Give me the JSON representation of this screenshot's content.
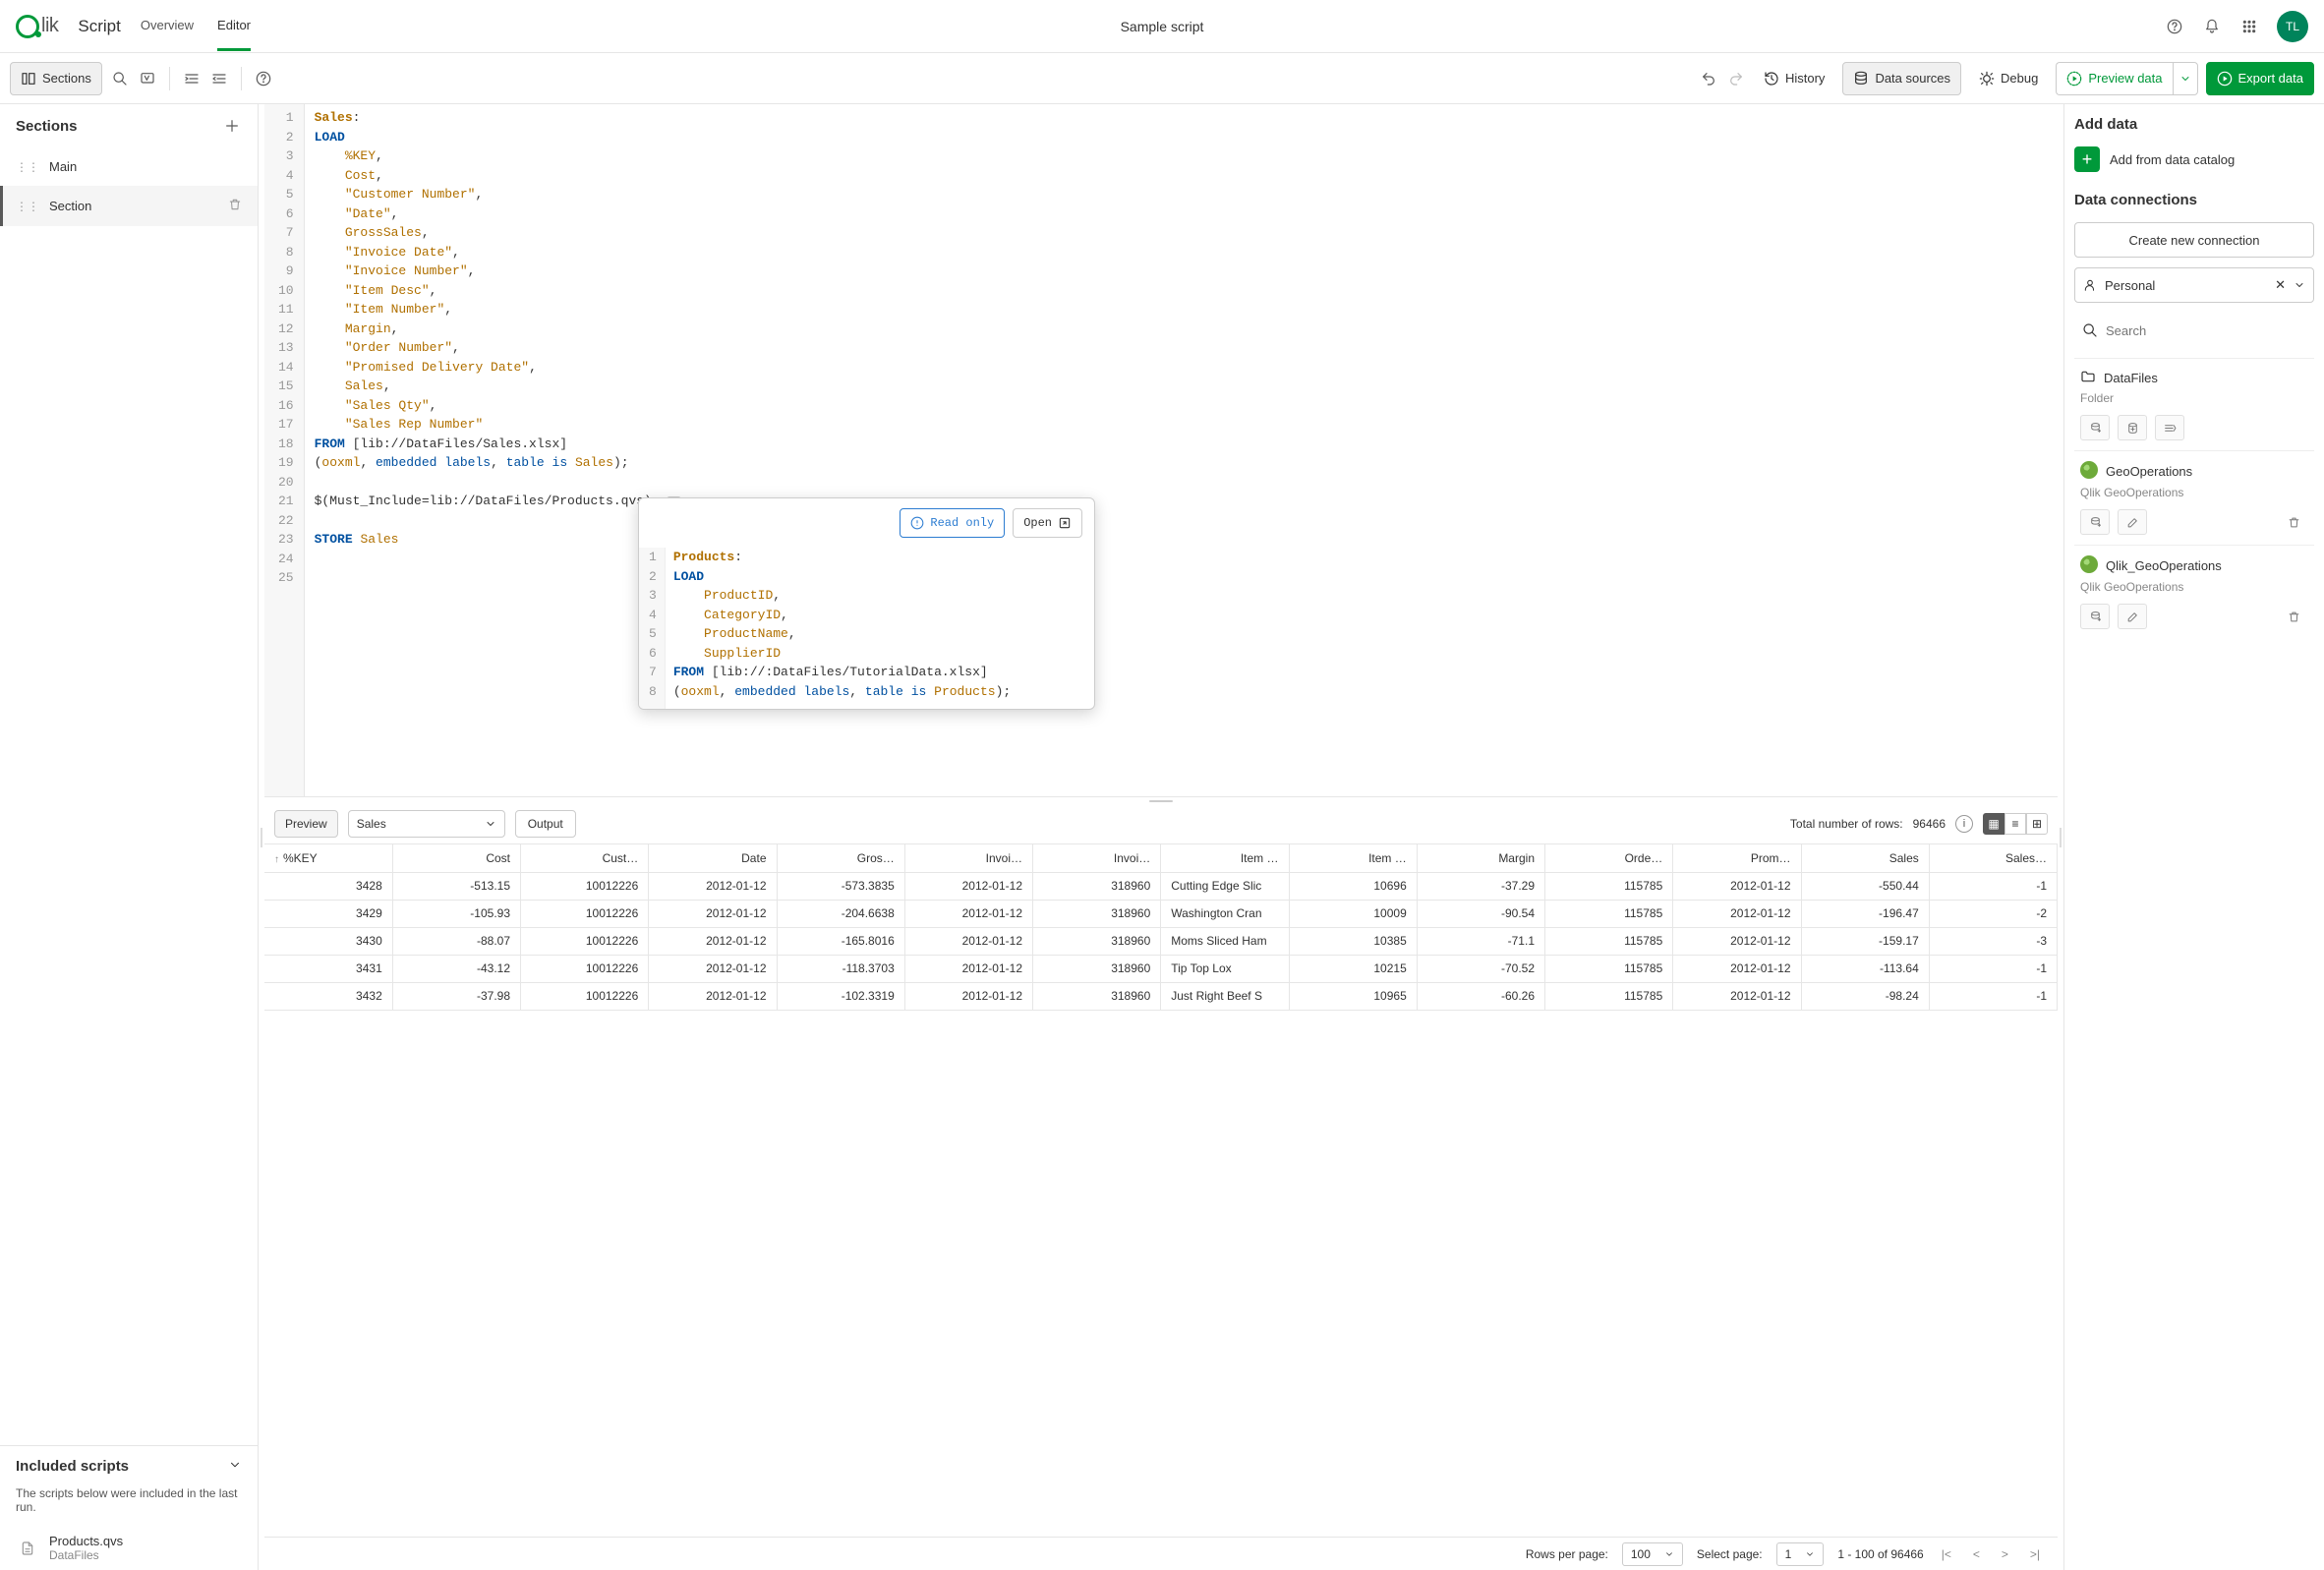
{
  "header": {
    "logo_text": "lik",
    "title": "Script",
    "tabs": [
      "Overview",
      "Editor"
    ],
    "active_tab": 1,
    "center_title": "Sample script",
    "avatar": "TL"
  },
  "toolbar": {
    "sections": "Sections",
    "history": "History",
    "datasources": "Data sources",
    "debug": "Debug",
    "preview": "Preview data",
    "export": "Export data"
  },
  "sections": {
    "title": "Sections",
    "items": [
      {
        "label": "Main",
        "active": false
      },
      {
        "label": "Section",
        "active": true
      }
    ]
  },
  "included": {
    "title": "Included scripts",
    "desc": "The scripts below were included in the last run.",
    "items": [
      {
        "name": "Products.qvs",
        "sub": "DataFiles"
      }
    ]
  },
  "code": {
    "lines": [
      {
        "n": 1,
        "html": "<span class='kw-label'>Sales</span>:"
      },
      {
        "n": 2,
        "html": "<span class='kw-load'>LOAD</span>"
      },
      {
        "n": 3,
        "html": "    <span class='kw-ident'>%KEY</span>,"
      },
      {
        "n": 4,
        "html": "    <span class='kw-ident'>Cost</span>,"
      },
      {
        "n": 5,
        "html": "    <span class='kw-str'>\"Customer Number\"</span>,"
      },
      {
        "n": 6,
        "html": "    <span class='kw-str'>\"Date\"</span>,"
      },
      {
        "n": 7,
        "html": "    <span class='kw-ident'>GrossSales</span>,"
      },
      {
        "n": 8,
        "html": "    <span class='kw-str'>\"Invoice Date\"</span>,"
      },
      {
        "n": 9,
        "html": "    <span class='kw-str'>\"Invoice Number\"</span>,"
      },
      {
        "n": 10,
        "html": "    <span class='kw-str'>\"Item Desc\"</span>,"
      },
      {
        "n": 11,
        "html": "    <span class='kw-str'>\"Item Number\"</span>,"
      },
      {
        "n": 12,
        "html": "    <span class='kw-ident'>Margin</span>,"
      },
      {
        "n": 13,
        "html": "    <span class='kw-str'>\"Order Number\"</span>,"
      },
      {
        "n": 14,
        "html": "    <span class='kw-str'>\"Promised Delivery Date\"</span>,"
      },
      {
        "n": 15,
        "html": "    <span class='kw-ident'>Sales</span>,"
      },
      {
        "n": 16,
        "html": "    <span class='kw-str'>\"Sales Qty\"</span>,"
      },
      {
        "n": 17,
        "html": "    <span class='kw-str'>\"Sales Rep Number\"</span>"
      },
      {
        "n": 18,
        "html": "<span class='kw-from'>FROM</span> [lib://DataFiles/Sales.xlsx]"
      },
      {
        "n": 19,
        "html": "(<span class='kw-ident'>ooxml</span>, <span class='kw-blue'>embedded</span> <span class='kw-blue'>labels</span>, <span class='kw-blue'>table</span> <span class='kw-blue'>is</span> <span class='kw-ident'>Sales</span>);"
      },
      {
        "n": 20,
        "html": ""
      },
      {
        "n": 21,
        "html": "$(Must_Include=lib://DataFiles/Products.qvs); <span style='border:1px solid #ccc;border-radius:3px;padding:0 3px;font-size:10px;color:#888;'>◇</span>"
      },
      {
        "n": 22,
        "html": ""
      },
      {
        "n": 23,
        "html": "<span class='kw-store'>STORE</span> <span class='kw-ident'>Sales</span>"
      },
      {
        "n": 24,
        "html": ""
      },
      {
        "n": 25,
        "html": ""
      }
    ]
  },
  "popup": {
    "readonly": "Read only",
    "open": "Open",
    "lines": [
      {
        "n": 1,
        "html": "<span class='kw-label'>Products</span>:"
      },
      {
        "n": 2,
        "html": "<span class='kw-load'>LOAD</span>"
      },
      {
        "n": 3,
        "html": "    <span class='kw-ident'>ProductID</span>,"
      },
      {
        "n": 4,
        "html": "    <span class='kw-ident'>CategoryID</span>,"
      },
      {
        "n": 5,
        "html": "    <span class='kw-ident'>ProductName</span>,"
      },
      {
        "n": 6,
        "html": "    <span class='kw-ident'>SupplierID</span>"
      },
      {
        "n": 7,
        "html": "<span class='kw-from'>FROM</span> [lib://:DataFiles/TutorialData.xlsx]"
      },
      {
        "n": 8,
        "html": "(<span class='kw-ident'>ooxml</span>, <span class='kw-blue'>embedded</span> <span class='kw-blue'>labels</span>, <span class='kw-blue'>table</span> <span class='kw-blue'>is</span> <span class='kw-ident'>Products</span>);"
      }
    ]
  },
  "right": {
    "add_data": "Add data",
    "catalog": "Add from data catalog",
    "connections_title": "Data connections",
    "create_conn": "Create new connection",
    "selected_space": "Personal",
    "search_placeholder": "Search",
    "connections": [
      {
        "name": "DataFiles",
        "sub": "Folder",
        "icon": "folder"
      },
      {
        "name": "GeoOperations",
        "sub": "Qlik GeoOperations",
        "icon": "globe"
      },
      {
        "name": "Qlik_GeoOperations",
        "sub": "Qlik GeoOperations",
        "icon": "globe"
      }
    ]
  },
  "preview": {
    "tab": "Preview",
    "table_select": "Sales",
    "output": "Output",
    "total_label": "Total number of rows:",
    "total": "96466",
    "columns": [
      "%KEY",
      "Cost",
      "Cust…",
      "Date",
      "Gros…",
      "Invoi…",
      "Invoi…",
      "Item …",
      "Item …",
      "Margin",
      "Orde…",
      "Prom…",
      "Sales",
      "Sales…"
    ],
    "rows": [
      [
        "3428",
        "-513.15",
        "10012226",
        "2012-01-12",
        "-573.3835",
        "2012-01-12",
        "318960",
        "Cutting Edge Slic",
        "10696",
        "-37.29",
        "115785",
        "2012-01-12",
        "-550.44",
        "-1"
      ],
      [
        "3429",
        "-105.93",
        "10012226",
        "2012-01-12",
        "-204.6638",
        "2012-01-12",
        "318960",
        "Washington Cran",
        "10009",
        "-90.54",
        "115785",
        "2012-01-12",
        "-196.47",
        "-2"
      ],
      [
        "3430",
        "-88.07",
        "10012226",
        "2012-01-12",
        "-165.8016",
        "2012-01-12",
        "318960",
        "Moms Sliced Ham",
        "10385",
        "-71.1",
        "115785",
        "2012-01-12",
        "-159.17",
        "-3"
      ],
      [
        "3431",
        "-43.12",
        "10012226",
        "2012-01-12",
        "-118.3703",
        "2012-01-12",
        "318960",
        "Tip Top Lox",
        "10215",
        "-70.52",
        "115785",
        "2012-01-12",
        "-113.64",
        "-1"
      ],
      [
        "3432",
        "-37.98",
        "10012226",
        "2012-01-12",
        "-102.3319",
        "2012-01-12",
        "318960",
        "Just Right Beef S",
        "10965",
        "-60.26",
        "115785",
        "2012-01-12",
        "-98.24",
        "-1"
      ]
    ]
  },
  "footer": {
    "rows_per_page_label": "Rows per page:",
    "rows_per_page": "100",
    "select_page_label": "Select page:",
    "select_page": "1",
    "range": "1 - 100 of 96466"
  }
}
